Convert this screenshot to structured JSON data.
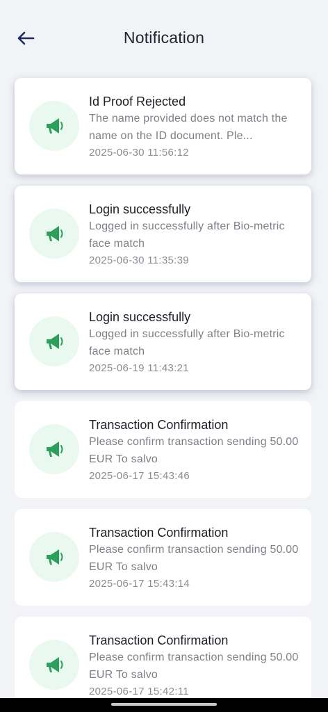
{
  "header": {
    "title": "Notification",
    "back_icon": "arrow-left-icon"
  },
  "colors": {
    "background": "#f1f3f6",
    "card": "#ffffff",
    "icon_bg": "#e9f9ef",
    "icon_green": "#2e9e5b",
    "title_text": "#1c1e26",
    "muted_text": "#7d8087",
    "back_arrow": "#1f2b5c"
  },
  "notifications": [
    {
      "icon": "megaphone-icon",
      "title": "Id Proof Rejected",
      "body": "The name provided does not match the name on the ID document. Ple...",
      "time": "2025-06-30 11:56:12",
      "unread": true
    },
    {
      "icon": "megaphone-icon",
      "title": "Login successfully",
      "body": "Logged in successfully after Bio-metric face match",
      "time": "2025-06-30 11:35:39",
      "unread": true
    },
    {
      "icon": "megaphone-icon",
      "title": "Login successfully",
      "body": "Logged in successfully after Bio-metric face match",
      "time": "2025-06-19 11:43:21",
      "unread": true
    },
    {
      "icon": "megaphone-icon",
      "title": "Transaction Confirmation",
      "body": "Please confirm transaction sending 50.00 EUR To salvo",
      "time": "2025-06-17 15:43:46",
      "unread": false
    },
    {
      "icon": "megaphone-icon",
      "title": "Transaction Confirmation",
      "body": "Please confirm transaction sending 50.00 EUR To salvo",
      "time": "2025-06-17 15:43:14",
      "unread": false
    },
    {
      "icon": "megaphone-icon",
      "title": "Transaction Confirmation",
      "body": "Please confirm transaction sending 50.00 EUR To salvo",
      "time": "2025-06-17 15:42:11",
      "unread": false
    }
  ]
}
